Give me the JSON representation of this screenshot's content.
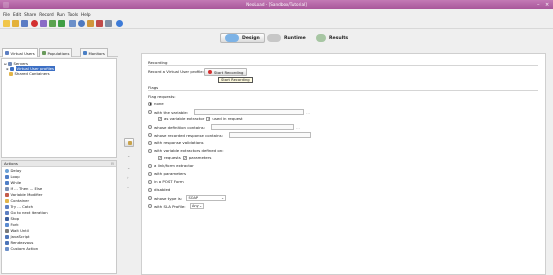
{
  "window": {
    "title": "NeoLoad - [Sandbox/Tutorial]",
    "min_icon": "minimize-icon",
    "close_icon": "close-icon"
  },
  "menu": [
    "File",
    "Edit",
    "Share",
    "Record",
    "Run",
    "Tools",
    "Help"
  ],
  "modes": [
    {
      "label": "Design",
      "active": true
    },
    {
      "label": "Runtime",
      "active": false
    },
    {
      "label": "Results",
      "active": false
    }
  ],
  "tabs": [
    {
      "label": "Virtual Users",
      "selected": true
    },
    {
      "label": "Populations",
      "selected": false
    },
    {
      "label": "Monitors",
      "selected": false
    }
  ],
  "tree": {
    "items": [
      {
        "label": "Servers",
        "level": 0
      },
      {
        "label": "Virtual User profiles",
        "level": 1,
        "selected": true
      },
      {
        "label": "Shared Containers",
        "level": 1
      }
    ]
  },
  "actions": {
    "header": "Actions",
    "items": [
      "Delay",
      "Loop",
      "While",
      "If ... Then ... Else",
      "Variable Modifier",
      "Container",
      "Try ... Catch",
      "Go to next iteration",
      "Stop",
      "Fork",
      "Wait Until",
      "JavaScript",
      "Rendezvous",
      "Custom Action"
    ]
  },
  "recording": {
    "section": "Recording",
    "label": "Record a Virtual User profile:",
    "button": "Start Recording",
    "tooltip": "Start Recording"
  },
  "flags": {
    "section": "Flags",
    "subtitle": "Flag requests:",
    "options": [
      {
        "label": "none",
        "checked": true
      },
      {
        "label": "with the variable:",
        "checked": false
      },
      {
        "label": "whose definition contains:",
        "checked": false
      },
      {
        "label": "whose recorded response contains:",
        "checked": false
      },
      {
        "label": "with response validations",
        "checked": false
      },
      {
        "label": "with variable extractors defined on:",
        "checked": false
      },
      {
        "label": "a link/form extractor",
        "checked": false
      },
      {
        "label": "with parameters",
        "checked": false
      },
      {
        "label": "in a POST Form",
        "checked": false
      },
      {
        "label": "disabled",
        "checked": false
      },
      {
        "label": "whose type is:",
        "checked": false
      },
      {
        "label": "with SLA Profile:",
        "checked": false
      }
    ],
    "var_sub_1": "as variable extractor",
    "var_sub_2": "used in request",
    "extr_sub_1": "requests",
    "extr_sub_2": "parameters",
    "type_value": "SOAP",
    "sla_value": "Any"
  },
  "colors": {
    "titlebar": "#b267a6",
    "selection": "#3c6fc4",
    "record_dot": "#d32f2f"
  }
}
